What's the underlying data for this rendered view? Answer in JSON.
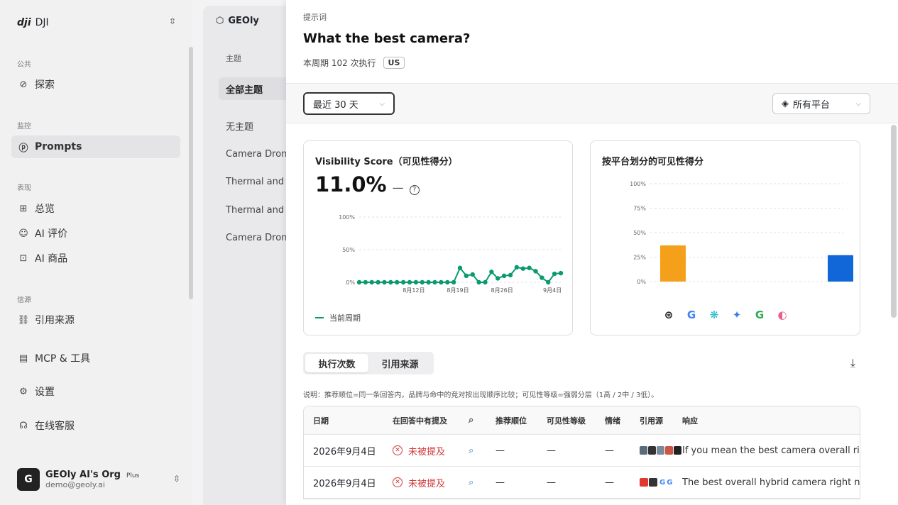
{
  "sidebar": {
    "org": "DJI",
    "logo": "dji",
    "sections": {
      "public": "公共",
      "monitor": "监控",
      "perf": "表现",
      "source": "信源"
    },
    "items": {
      "explore": "探索",
      "prompts": "Prompts",
      "overview": "总览",
      "ai_review": "AI 评价",
      "ai_products": "AI 商品",
      "citations": "引用来源",
      "mcp": "MCP & 工具",
      "settings": "设置",
      "support": "在线客服"
    },
    "user": {
      "initial": "G",
      "name": "GEOly AI's Org",
      "plan": "Plus",
      "email": "demo@geoly.ai"
    }
  },
  "middle": {
    "tab": "GEOly",
    "header": "主题",
    "items": [
      "全部主题",
      "无主题",
      "Camera Drones",
      "Thermal and",
      "Thermal and",
      "Camera Drones"
    ]
  },
  "panel": {
    "kicker": "提示词",
    "title": "What the best camera?",
    "runs": "本周期 102 次执行",
    "region": "US",
    "range": "最近 30 天",
    "platform": "所有平台",
    "score_card": {
      "title": "Visibility Score（可见性得分）",
      "value": "11.0%",
      "delta": "—",
      "help": "?",
      "legend": "当前周期"
    },
    "platform_card": {
      "title": "按平台划分的可见性得分"
    },
    "tabs": [
      "执行次数",
      "引用来源"
    ],
    "note": "说明：推荐顺位=同一条回答内，品牌与命中的竞对按出现顺序比较；可见性等级=强弱分层（1高 / 2中 / 3低）。",
    "table": {
      "headers": {
        "date": "日期",
        "mentioned": "在回答中有提及",
        "rank": "推荐顺位",
        "level": "可见性等级",
        "sentiment": "情绪",
        "sources": "引用源",
        "response": "响应"
      },
      "rows": [
        {
          "date": "2026年9月4日",
          "mentioned": "未被提及",
          "rank": "—",
          "level": "—",
          "sentiment": "—",
          "response": "If you mean the best camera overall right now"
        },
        {
          "date": "2026年9月4日",
          "mentioned": "未被提及",
          "rank": "—",
          "level": "—",
          "sentiment": "—",
          "response": "The best overall hybrid camera right now"
        }
      ]
    }
  },
  "chart_data": [
    {
      "type": "line",
      "title": "Visibility Score（可见性得分）",
      "yticks": [
        "100%",
        "50%",
        "0%"
      ],
      "ylim": [
        0,
        100
      ],
      "xticks": [
        "8月12日",
        "8月19日",
        "8月26日",
        "9月4日"
      ],
      "series": [
        {
          "name": "当前周期",
          "color": "#0a9a6e",
          "values": [
            0,
            0,
            0,
            0,
            0,
            0,
            0,
            0,
            0,
            0,
            0,
            0,
            0,
            0,
            0,
            0,
            22,
            10,
            12,
            0,
            0,
            16,
            6,
            10,
            11,
            23,
            21,
            22,
            17,
            7,
            0,
            13,
            14
          ]
        }
      ],
      "grid": true
    },
    {
      "type": "bar",
      "title": "按平台划分的可见性得分",
      "yticks": [
        "100%",
        "75%",
        "50%",
        "25%",
        "0%"
      ],
      "ylim": [
        0,
        100
      ],
      "categories": [
        "chatgpt",
        "google-ai-overview",
        "perplexity",
        "gemini",
        "google-ai-mode",
        "copilot"
      ],
      "values": [
        37,
        0,
        0,
        0,
        0,
        27
      ],
      "colors": [
        "#f5a01a",
        "#f5a01a",
        "#f5a01a",
        "#f5a01a",
        "#f5a01a",
        "#1166d8"
      ],
      "grid": true
    }
  ]
}
